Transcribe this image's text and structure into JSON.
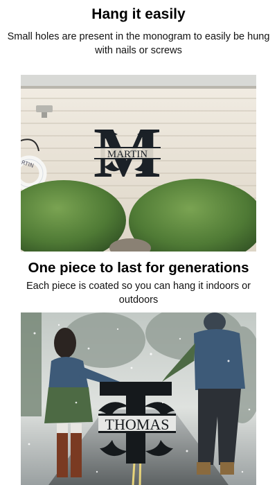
{
  "section1": {
    "heading": "Hang it easily",
    "description": "Small holes are present in the monogram to easily be hung with nails or screws",
    "photo": {
      "monogram_letter": "M",
      "monogram_name": "MARTIN",
      "wreath_text": "RTIN"
    }
  },
  "section2": {
    "heading": "One piece to last for generations",
    "description": "Each piece is coated so you can hang it indoors or outdoors",
    "photo": {
      "monogram_letter": "T",
      "monogram_name": "THOMAS"
    }
  },
  "colors": {
    "monogram_fill": "#1b2127",
    "siding": "#e9e2d6",
    "shrub": "#4f7a35",
    "snow_sky": "#cfd3d1",
    "jacket_denim": "#3d5a78",
    "sweater_green": "#4d6a44"
  }
}
